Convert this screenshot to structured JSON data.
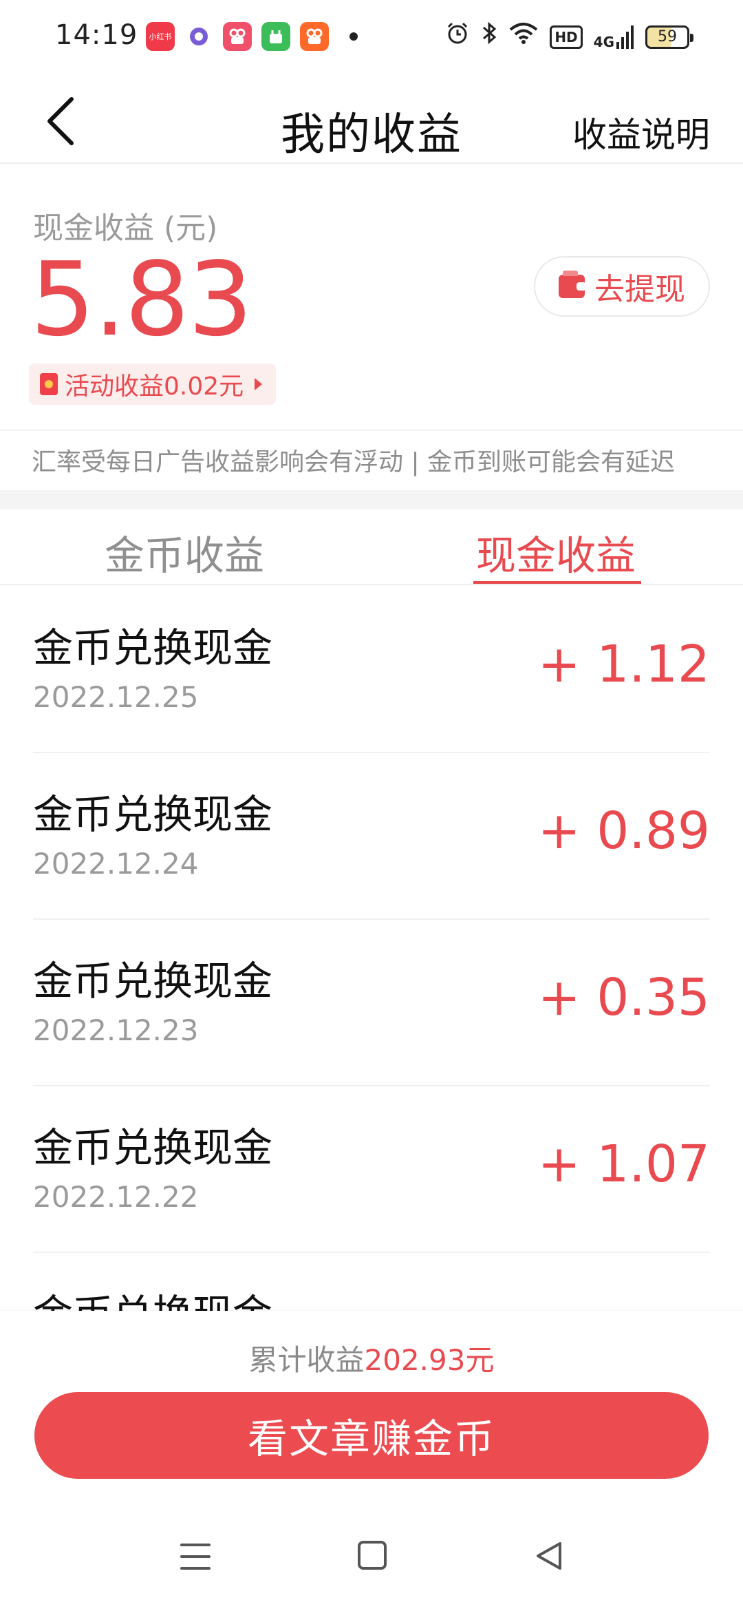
{
  "status_bar": {
    "time": "14:19",
    "app_icons": [
      {
        "name": "xiaohongshu-icon",
        "color": "#f03a4a",
        "label": "小红书"
      },
      {
        "name": "browser-icon",
        "color": "#7a5cd6",
        "label": ""
      },
      {
        "name": "kuaishou-icon-1",
        "color": "#f0506a",
        "label": ""
      },
      {
        "name": "app-green-icon",
        "color": "#3dbd5a",
        "label": ""
      },
      {
        "name": "kuaishou-icon-2",
        "color": "#ff6a2b",
        "label": ""
      }
    ],
    "hd_label": "HD",
    "network_label": "4G",
    "battery": "59"
  },
  "header": {
    "title": "我的收益",
    "explain_link": "收益说明"
  },
  "summary": {
    "cash_label": "现金收益 (元)",
    "cash_value": "5.83",
    "withdraw_label": "去提现",
    "activity_label": "活动收益0.02元"
  },
  "notice": "汇率受每日广告收益影响会有浮动 | 金币到账可能会有延迟",
  "tabs": [
    {
      "label": "金币收益",
      "active": false
    },
    {
      "label": "现金收益",
      "active": true
    }
  ],
  "records": [
    {
      "title": "金币兑换现金",
      "date": "2022.12.25",
      "amount": "+ 1.12"
    },
    {
      "title": "金币兑换现金",
      "date": "2022.12.24",
      "amount": "+ 0.89"
    },
    {
      "title": "金币兑换现金",
      "date": "2022.12.23",
      "amount": "+ 0.35"
    },
    {
      "title": "金币兑换现金",
      "date": "2022.12.22",
      "amount": "+ 1.07"
    },
    {
      "title": "金币兑换现金",
      "date": "",
      "amount": ""
    }
  ],
  "footer": {
    "total_label": "累计收益",
    "total_value": "202.93元",
    "cta_label": "看文章赚金币"
  },
  "colors": {
    "accent": "#e84a4f",
    "muted": "#9a9a9a"
  }
}
